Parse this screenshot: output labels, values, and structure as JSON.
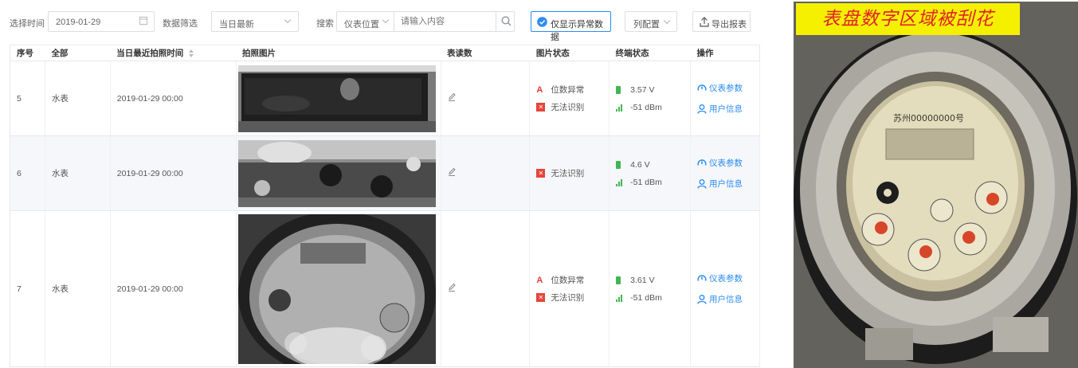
{
  "toolbar": {
    "date_label": "选择时间",
    "date_value": "2019-01-29",
    "filter_label": "数据筛选",
    "filter_value": "当日最新",
    "search_label": "搜索",
    "search_field_value": "仪表位置",
    "search_placeholder": "请输入内容",
    "abnormal_toggle_label": "仅显示异常数据",
    "columns_button": "列配置",
    "export_button": "导出报表"
  },
  "table": {
    "headers": [
      "序号",
      "全部",
      "当日最近拍照时间",
      "拍照图片",
      "表读数",
      "图片状态",
      "终端状态",
      "操作"
    ],
    "rows": [
      {
        "index": "5",
        "type": "水表",
        "time": "2019-01-29 00:00",
        "status_digit": "位数异常",
        "status_unreadable": "无法识别",
        "voltage": "3.57 V",
        "signal": "-51 dBm",
        "op_params": "仪表参数",
        "op_user": "用户信息"
      },
      {
        "index": "6",
        "type": "水表",
        "time": "2019-01-29 00:00",
        "status_unreadable": "无法识别",
        "voltage": "4.6 V",
        "signal": "-51 dBm",
        "op_params": "仪表参数",
        "op_user": "用户信息"
      },
      {
        "index": "7",
        "type": "水表",
        "time": "2019-01-29 00:00",
        "status_digit": "位数异常",
        "status_unreadable": "无法识别",
        "voltage": "3.61 V",
        "signal": "-51 dBm",
        "op_params": "仪表参数",
        "op_user": "用户信息"
      }
    ]
  },
  "side_photo": {
    "caption": "表盘数字区域被刮花",
    "meter_serial": "苏州00000000号"
  },
  "colors": {
    "accent": "#2d8cf0",
    "danger": "#e5453a",
    "ok": "#43b553",
    "caption_bg": "#f5f000",
    "caption_text": "#e0222b"
  },
  "icons": [
    "calendar-icon",
    "chevron-down-icon",
    "search-icon",
    "check-circle-icon",
    "upload-icon",
    "sort-icon",
    "edit-icon",
    "battery-icon",
    "signal-icon",
    "gauge-icon",
    "user-icon"
  ]
}
